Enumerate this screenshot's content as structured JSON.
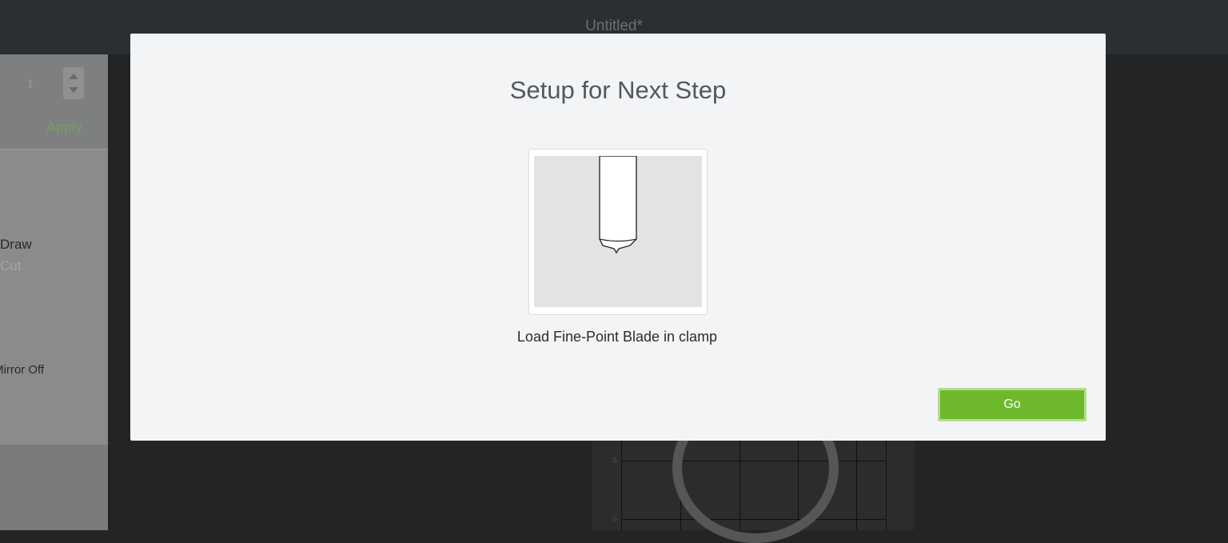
{
  "window": {
    "title": "Untitled*"
  },
  "left_panel": {
    "copies_value": "1",
    "apply_label": "Apply",
    "mode_draw": "Draw",
    "mode_cut": "Cut",
    "mirror_label": "Mirror Off"
  },
  "mat": {
    "row_labels": [
      "5",
      "6"
    ]
  },
  "modal": {
    "title": "Setup for Next Step",
    "step_caption": "Load Fine-Point Blade in clamp",
    "step_icon": "fine-point-blade-illustration",
    "go_label": "Go"
  },
  "colors": {
    "accent_green": "#6db92b",
    "modal_bg": "#f3f4f6",
    "app_bg": "#222425"
  }
}
